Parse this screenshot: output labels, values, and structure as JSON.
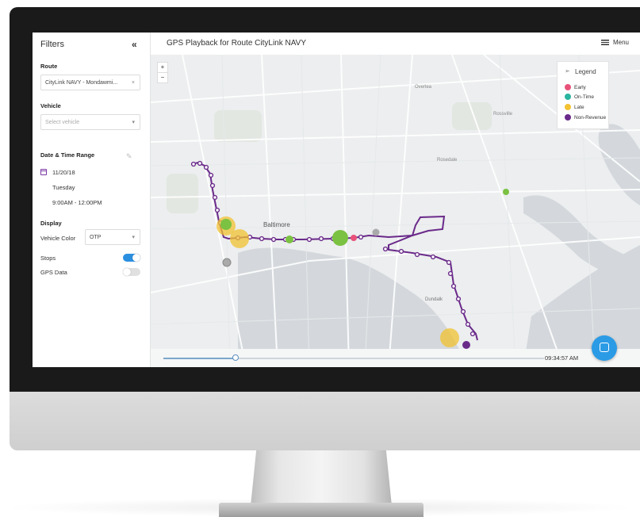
{
  "sidebar": {
    "title": "Filters",
    "collapse_icon": "«",
    "route": {
      "label": "Route",
      "value": "CityLink NAVY - Mondawmi...",
      "clear_icon": "×"
    },
    "vehicle": {
      "label": "Vehicle",
      "placeholder": "Select vehicle",
      "chevron": "▾"
    },
    "date_time": {
      "label": "Date & Time Range",
      "date": "11/20/18",
      "weekday": "Tuesday",
      "time_range": "9:00AM - 12:00PM"
    },
    "display": {
      "label": "Display",
      "vehicle_color_label": "Vehicle Color",
      "vehicle_color_value": "OTP",
      "stops_label": "Stops",
      "stops_on": true,
      "gps_label": "GPS Data",
      "gps_on": false
    }
  },
  "header": {
    "title": "GPS Playback for Route CityLink NAVY",
    "menu_label": "Menu"
  },
  "map": {
    "zoom_in": "+",
    "zoom_out": "−",
    "labels": {
      "baltimore": "Baltimore",
      "rosedale": "Rosedale",
      "overlea": "Overlea",
      "rossville": "Rossville",
      "dundalk": "Dundalk"
    },
    "legend": {
      "title": "Legend",
      "items": [
        {
          "label": "Early",
          "color": "#e8527a"
        },
        {
          "label": "On-Time",
          "color": "#2bb5a0"
        },
        {
          "label": "Late",
          "color": "#f2c230"
        },
        {
          "label": "Non-Revenue",
          "color": "#6a2a8a"
        }
      ]
    }
  },
  "playback": {
    "time": "09:34:57 AM",
    "progress": 0.19
  },
  "colors": {
    "route": "#6a2a8a",
    "accent": "#2b8fe0"
  }
}
